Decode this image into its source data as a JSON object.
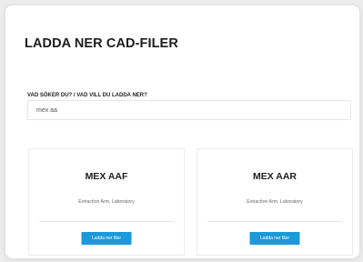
{
  "page": {
    "title": "LADDA NER CAD-FILER"
  },
  "search": {
    "label": "VAD SÖKER DU? / VAD VILL DU LADDA NER?",
    "value": "mex aa"
  },
  "products": [
    {
      "name": "MEX AAF",
      "description": "Extraction Arm, Laboratory",
      "button_label": "Ladda ner filer"
    },
    {
      "name": "MEX AAR",
      "description": "Extraction Arm, Laboratory",
      "button_label": "Ladda ner filer"
    }
  ],
  "colors": {
    "button": "#1a9ad9",
    "background": "#ececec",
    "card": "#ffffff"
  }
}
